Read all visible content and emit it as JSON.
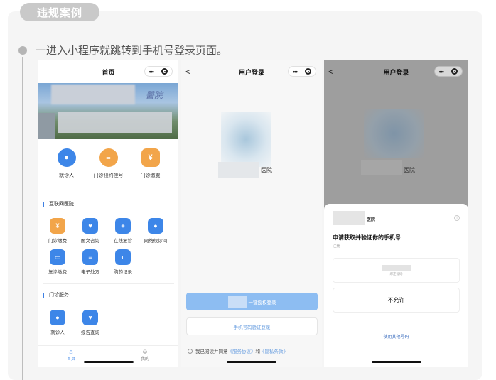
{
  "badge": "违规案例",
  "description": "一进入小程序就跳转到手机号登录页面。",
  "phone1": {
    "title": "首页",
    "banner_mark": "醫院",
    "top_grid": [
      {
        "label": "就诊人",
        "icon": "person-icon",
        "color": "#3d86e8"
      },
      {
        "label": "门诊预约挂号",
        "icon": "clipboard-icon",
        "color": "#f2a54a"
      },
      {
        "label": "门诊缴费",
        "icon": "yuan-wallet-icon",
        "color": "#f2a54a"
      }
    ],
    "section1": "互联网医院",
    "internet_grid": [
      {
        "label": "门诊缴费",
        "icon": "yuan-wallet-icon",
        "color": "#f2a54a"
      },
      {
        "label": "图文咨询",
        "icon": "chat-heart-icon",
        "color": "#3d86e8"
      },
      {
        "label": "在线复诊",
        "icon": "medical-kit-icon",
        "color": "#3d86e8"
      },
      {
        "label": "网络候诊间",
        "icon": "person-icon",
        "color": "#3d86e8"
      },
      {
        "label": "复诊缴费",
        "icon": "card-icon",
        "color": "#3d86e8"
      },
      {
        "label": "电子处方",
        "icon": "prescription-icon",
        "color": "#3d86e8"
      },
      {
        "label": "购药记录",
        "icon": "pill-icon",
        "color": "#3d86e8"
      }
    ],
    "section2": "门诊服务",
    "service_grid": [
      {
        "label": "就诊人",
        "icon": "person-icon",
        "color": "#3d86e8"
      },
      {
        "label": "报告查询",
        "icon": "heart-pulse-icon",
        "color": "#3d86e8"
      }
    ],
    "tabs": [
      {
        "label": "首页",
        "icon": "home-icon"
      },
      {
        "label": "我的",
        "icon": "profile-icon"
      }
    ]
  },
  "phone2": {
    "title": "用户登录",
    "hospital": "医院",
    "primary_button": "一键授权登录",
    "secondary_button": "手机号码验证登录",
    "agree_prefix": "我已阅读并同意",
    "service_link": "《服务协议》",
    "and": "和",
    "privacy_link": "《隐私条款》"
  },
  "phone3": {
    "title": "用户登录",
    "hospital": "医院",
    "app_name": "医院",
    "request": "申请获取并验证你的手机号",
    "sub": "注册",
    "number_hint": "绑定号码",
    "deny": "不允许",
    "other": "使用其他号码"
  }
}
